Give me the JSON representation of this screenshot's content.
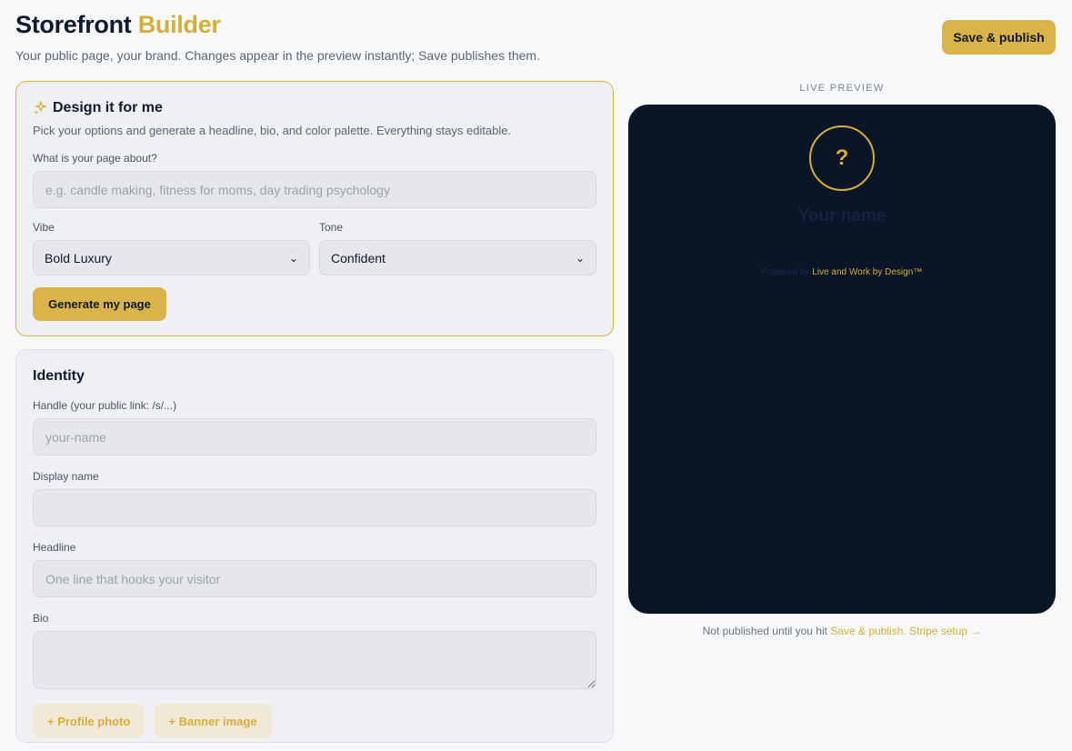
{
  "header": {
    "title_main": "Storefront",
    "title_accent": "Builder",
    "subtitle": "Your public page, your brand. Changes appear in the preview instantly; Save publishes them.",
    "save_label": "Save & publish"
  },
  "design": {
    "title": "Design it for me",
    "description": "Pick your options and generate a headline, bio, and color palette. Everything stays editable.",
    "about_label": "What is your page about?",
    "about_placeholder": "e.g. candle making, fitness for moms, day trading psychology",
    "vibe_label": "Vibe",
    "vibe_value": "Bold Luxury",
    "tone_label": "Tone",
    "tone_value": "Confident",
    "generate_label": "Generate my page"
  },
  "identity": {
    "title": "Identity",
    "handle_label": "Handle (your public link: /s/...)",
    "handle_placeholder": "your-name",
    "display_label": "Display name",
    "display_value": "",
    "headline_label": "Headline",
    "headline_placeholder": "One line that hooks your visitor",
    "bio_label": "Bio",
    "bio_value": "",
    "profile_photo_label": "+ Profile photo",
    "banner_label": "+ Banner image"
  },
  "preview": {
    "label": "LIVE PREVIEW",
    "avatar_placeholder": "?",
    "name": "Your name",
    "powered_prefix": "Powered by",
    "brand": "Live and Work by Design™",
    "footnote_prefix": "Not published until you hit",
    "footnote_link1": "Save & publish.",
    "footnote_link2": "Stripe setup →"
  },
  "colors": {
    "accent": "#d4af37",
    "preview_bg": "#0a1628"
  }
}
